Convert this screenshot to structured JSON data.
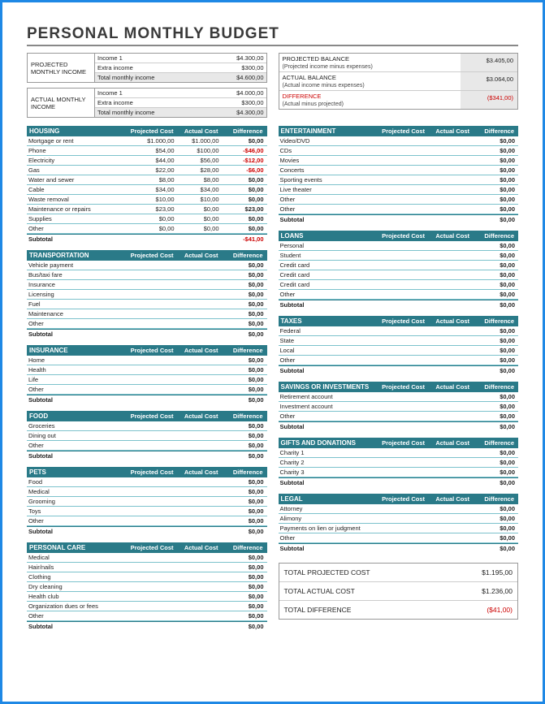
{
  "title": "PERSONAL MONTHLY BUDGET",
  "income": {
    "projected": {
      "label1": "PROJECTED",
      "label2": "MONTHLY INCOME",
      "rows": [
        {
          "lbl": "Income 1",
          "val": "$4.300,00"
        },
        {
          "lbl": "Extra income",
          "val": "$300,00"
        },
        {
          "lbl": "Total monthly income",
          "val": "$4.600,00"
        }
      ]
    },
    "actual": {
      "label1": "ACTUAL MONTHLY",
      "label2": "INCOME",
      "rows": [
        {
          "lbl": "Income 1",
          "val": "$4.000,00"
        },
        {
          "lbl": "Extra income",
          "val": "$300,00"
        },
        {
          "lbl": "Total monthly income",
          "val": "$4.300,00"
        }
      ]
    }
  },
  "balance": [
    {
      "lbl": "PROJECTED BALANCE",
      "sub": "(Projected income minus expenses)",
      "val": "$3.405,00",
      "neg": false
    },
    {
      "lbl": "ACTUAL BALANCE",
      "sub": "(Actual income minus expenses)",
      "val": "$3.064,00",
      "neg": false
    },
    {
      "lbl": "DIFFERENCE",
      "sub": "(Actual minus projected)",
      "val": "($341,00)",
      "neg": true
    }
  ],
  "headers": {
    "pc": "Projected Cost",
    "ac": "Actual Cost",
    "df": "Difference"
  },
  "left": [
    {
      "name": "HOUSING",
      "rows": [
        {
          "n": "Mortgage or rent",
          "p": "$1.000,00",
          "a": "$1.000,00",
          "d": "$0,00"
        },
        {
          "n": "Phone",
          "p": "$54,00",
          "a": "$100,00",
          "d": "-$46,00",
          "neg": true
        },
        {
          "n": "Electricity",
          "p": "$44,00",
          "a": "$56,00",
          "d": "-$12,00",
          "neg": true
        },
        {
          "n": "Gas",
          "p": "$22,00",
          "a": "$28,00",
          "d": "-$6,00",
          "neg": true
        },
        {
          "n": "Water and sewer",
          "p": "$8,00",
          "a": "$8,00",
          "d": "$0,00"
        },
        {
          "n": "Cable",
          "p": "$34,00",
          "a": "$34,00",
          "d": "$0,00"
        },
        {
          "n": "Waste removal",
          "p": "$10,00",
          "a": "$10,00",
          "d": "$0,00"
        },
        {
          "n": "Maintenance or repairs",
          "p": "$23,00",
          "a": "$0,00",
          "d": "$23,00"
        },
        {
          "n": "Supplies",
          "p": "$0,00",
          "a": "$0,00",
          "d": "$0,00"
        },
        {
          "n": "Other",
          "p": "$0,00",
          "a": "$0,00",
          "d": "$0,00"
        }
      ],
      "sub": "-$41,00",
      "subneg": true
    },
    {
      "name": "TRANSPORTATION",
      "rows": [
        {
          "n": "Vehicle payment",
          "p": "",
          "a": "",
          "d": "$0,00"
        },
        {
          "n": "Bus/taxi fare",
          "p": "",
          "a": "",
          "d": "$0,00"
        },
        {
          "n": "Insurance",
          "p": "",
          "a": "",
          "d": "$0,00"
        },
        {
          "n": "Licensing",
          "p": "",
          "a": "",
          "d": "$0,00"
        },
        {
          "n": "Fuel",
          "p": "",
          "a": "",
          "d": "$0,00"
        },
        {
          "n": "Maintenance",
          "p": "",
          "a": "",
          "d": "$0,00"
        },
        {
          "n": "Other",
          "p": "",
          "a": "",
          "d": "$0,00"
        }
      ],
      "sub": "$0,00"
    },
    {
      "name": "INSURANCE",
      "rows": [
        {
          "n": "Home",
          "p": "",
          "a": "",
          "d": "$0,00"
        },
        {
          "n": "Health",
          "p": "",
          "a": "",
          "d": "$0,00"
        },
        {
          "n": "Life",
          "p": "",
          "a": "",
          "d": "$0,00"
        },
        {
          "n": "Other",
          "p": "",
          "a": "",
          "d": "$0,00"
        }
      ],
      "sub": "$0,00"
    },
    {
      "name": "FOOD",
      "rows": [
        {
          "n": "Groceries",
          "p": "",
          "a": "",
          "d": "$0,00"
        },
        {
          "n": "Dining out",
          "p": "",
          "a": "",
          "d": "$0,00"
        },
        {
          "n": "Other",
          "p": "",
          "a": "",
          "d": "$0,00"
        }
      ],
      "sub": "$0,00"
    },
    {
      "name": "PETS",
      "rows": [
        {
          "n": "Food",
          "p": "",
          "a": "",
          "d": "$0,00"
        },
        {
          "n": "Medical",
          "p": "",
          "a": "",
          "d": "$0,00"
        },
        {
          "n": "Grooming",
          "p": "",
          "a": "",
          "d": "$0,00"
        },
        {
          "n": "Toys",
          "p": "",
          "a": "",
          "d": "$0,00"
        },
        {
          "n": "Other",
          "p": "",
          "a": "",
          "d": "$0,00"
        }
      ],
      "sub": "$0,00"
    },
    {
      "name": "PERSONAL CARE",
      "rows": [
        {
          "n": "Medical",
          "p": "",
          "a": "",
          "d": "$0,00"
        },
        {
          "n": "Hair/nails",
          "p": "",
          "a": "",
          "d": "$0,00"
        },
        {
          "n": "Clothing",
          "p": "",
          "a": "",
          "d": "$0,00"
        },
        {
          "n": "Dry cleaning",
          "p": "",
          "a": "",
          "d": "$0,00"
        },
        {
          "n": "Health club",
          "p": "",
          "a": "",
          "d": "$0,00"
        },
        {
          "n": "Organization dues or fees",
          "p": "",
          "a": "",
          "d": "$0,00"
        },
        {
          "n": "Other",
          "p": "",
          "a": "",
          "d": "$0,00"
        }
      ],
      "sub": "$0,00"
    }
  ],
  "right": [
    {
      "name": "ENTERTAINMENT",
      "rows": [
        {
          "n": "Video/DVD",
          "p": "",
          "a": "",
          "d": "$0,00"
        },
        {
          "n": "CDs",
          "p": "",
          "a": "",
          "d": "$0,00"
        },
        {
          "n": "Movies",
          "p": "",
          "a": "",
          "d": "$0,00"
        },
        {
          "n": "Concerts",
          "p": "",
          "a": "",
          "d": "$0,00"
        },
        {
          "n": "Sporting events",
          "p": "",
          "a": "",
          "d": "$0,00"
        },
        {
          "n": "Live theater",
          "p": "",
          "a": "",
          "d": "$0,00"
        },
        {
          "n": "Other",
          "p": "",
          "a": "",
          "d": "$0,00"
        },
        {
          "n": "Other",
          "p": "",
          "a": "",
          "d": "$0,00"
        }
      ],
      "sub": "$0,00"
    },
    {
      "name": "LOANS",
      "rows": [
        {
          "n": "Personal",
          "p": "",
          "a": "",
          "d": "$0,00"
        },
        {
          "n": "Student",
          "p": "",
          "a": "",
          "d": "$0,00"
        },
        {
          "n": "Credit card",
          "p": "",
          "a": "",
          "d": "$0,00"
        },
        {
          "n": "Credit card",
          "p": "",
          "a": "",
          "d": "$0,00"
        },
        {
          "n": "Credit card",
          "p": "",
          "a": "",
          "d": "$0,00"
        },
        {
          "n": "Other",
          "p": "",
          "a": "",
          "d": "$0,00"
        }
      ],
      "sub": "$0,00"
    },
    {
      "name": "TAXES",
      "rows": [
        {
          "n": "Federal",
          "p": "",
          "a": "",
          "d": "$0,00"
        },
        {
          "n": "State",
          "p": "",
          "a": "",
          "d": "$0,00"
        },
        {
          "n": "Local",
          "p": "",
          "a": "",
          "d": "$0,00"
        },
        {
          "n": "Other",
          "p": "",
          "a": "",
          "d": "$0,00"
        }
      ],
      "sub": "$0,00"
    },
    {
      "name": "SAVINGS OR INVESTMENTS",
      "rows": [
        {
          "n": "Retirement account",
          "p": "",
          "a": "",
          "d": "$0,00"
        },
        {
          "n": "Investment account",
          "p": "",
          "a": "",
          "d": "$0,00"
        },
        {
          "n": "Other",
          "p": "",
          "a": "",
          "d": "$0,00"
        }
      ],
      "sub": "$0,00"
    },
    {
      "name": "GIFTS AND DONATIONS",
      "rows": [
        {
          "n": "Charity 1",
          "p": "",
          "a": "",
          "d": "$0,00"
        },
        {
          "n": "Charity 2",
          "p": "",
          "a": "",
          "d": "$0,00"
        },
        {
          "n": "Charity 3",
          "p": "",
          "a": "",
          "d": "$0,00"
        }
      ],
      "sub": "$0,00"
    },
    {
      "name": "LEGAL",
      "rows": [
        {
          "n": "Attorney",
          "p": "",
          "a": "",
          "d": "$0,00"
        },
        {
          "n": "Alimony",
          "p": "",
          "a": "",
          "d": "$0,00"
        },
        {
          "n": "Payments on lien or judgment",
          "p": "",
          "a": "",
          "d": "$0,00"
        },
        {
          "n": "Other",
          "p": "",
          "a": "",
          "d": "$0,00"
        }
      ],
      "sub": "$0,00"
    }
  ],
  "totals": [
    {
      "lbl": "TOTAL PROJECTED COST",
      "val": "$1.195,00"
    },
    {
      "lbl": "TOTAL ACTUAL COST",
      "val": "$1.236,00"
    },
    {
      "lbl": "TOTAL DIFFERENCE",
      "val": "($41,00)",
      "neg": true
    }
  ],
  "subtotal_label": "Subtotal"
}
